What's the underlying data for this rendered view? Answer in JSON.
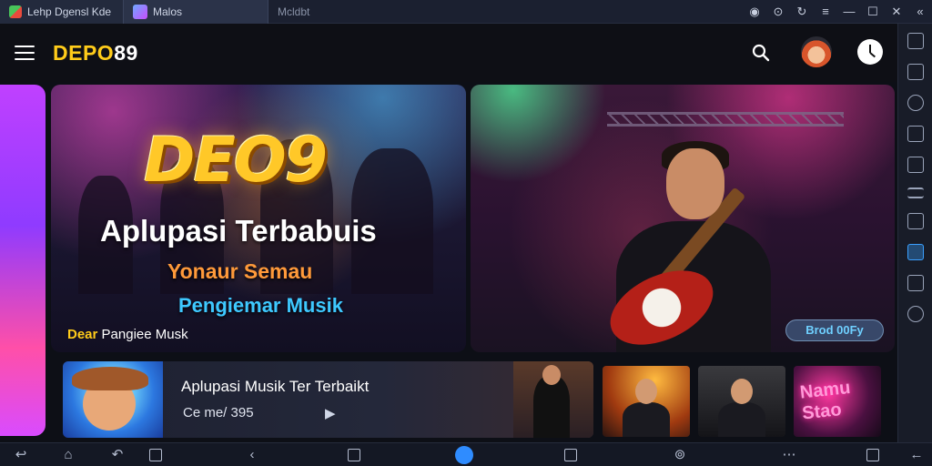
{
  "window": {
    "tabs": [
      {
        "label": "Lehp Dgensl Kde"
      },
      {
        "label": "Malos"
      },
      {
        "label": "Mcldbt"
      }
    ]
  },
  "header": {
    "brand_prefix": "DEPO",
    "brand_suffix": "89"
  },
  "banner_left": {
    "logo_text": "DEO9",
    "headline": "Aplupasi Terbabuis",
    "subheadline": "Yonaur Semau",
    "tagline": "Pengiemar Musik",
    "footer_prefix": "Dear",
    "footer_text": "Pangiee Musk"
  },
  "banner_right": {
    "badge": "Brod 00Fy"
  },
  "row": {
    "title": "Aplupasi Musik Ter Terbaikt",
    "meta": "Ce me/  395"
  },
  "tiles": [
    {
      "label": ""
    },
    {
      "label": ""
    },
    {
      "label": "Namu Stao"
    }
  ],
  "colors": {
    "brand_accent": "#ffcc1a",
    "tagline_blue": "#3ec9ff",
    "subheadline_orange": "#ff9a3a",
    "nav_active": "#2f8cff"
  }
}
